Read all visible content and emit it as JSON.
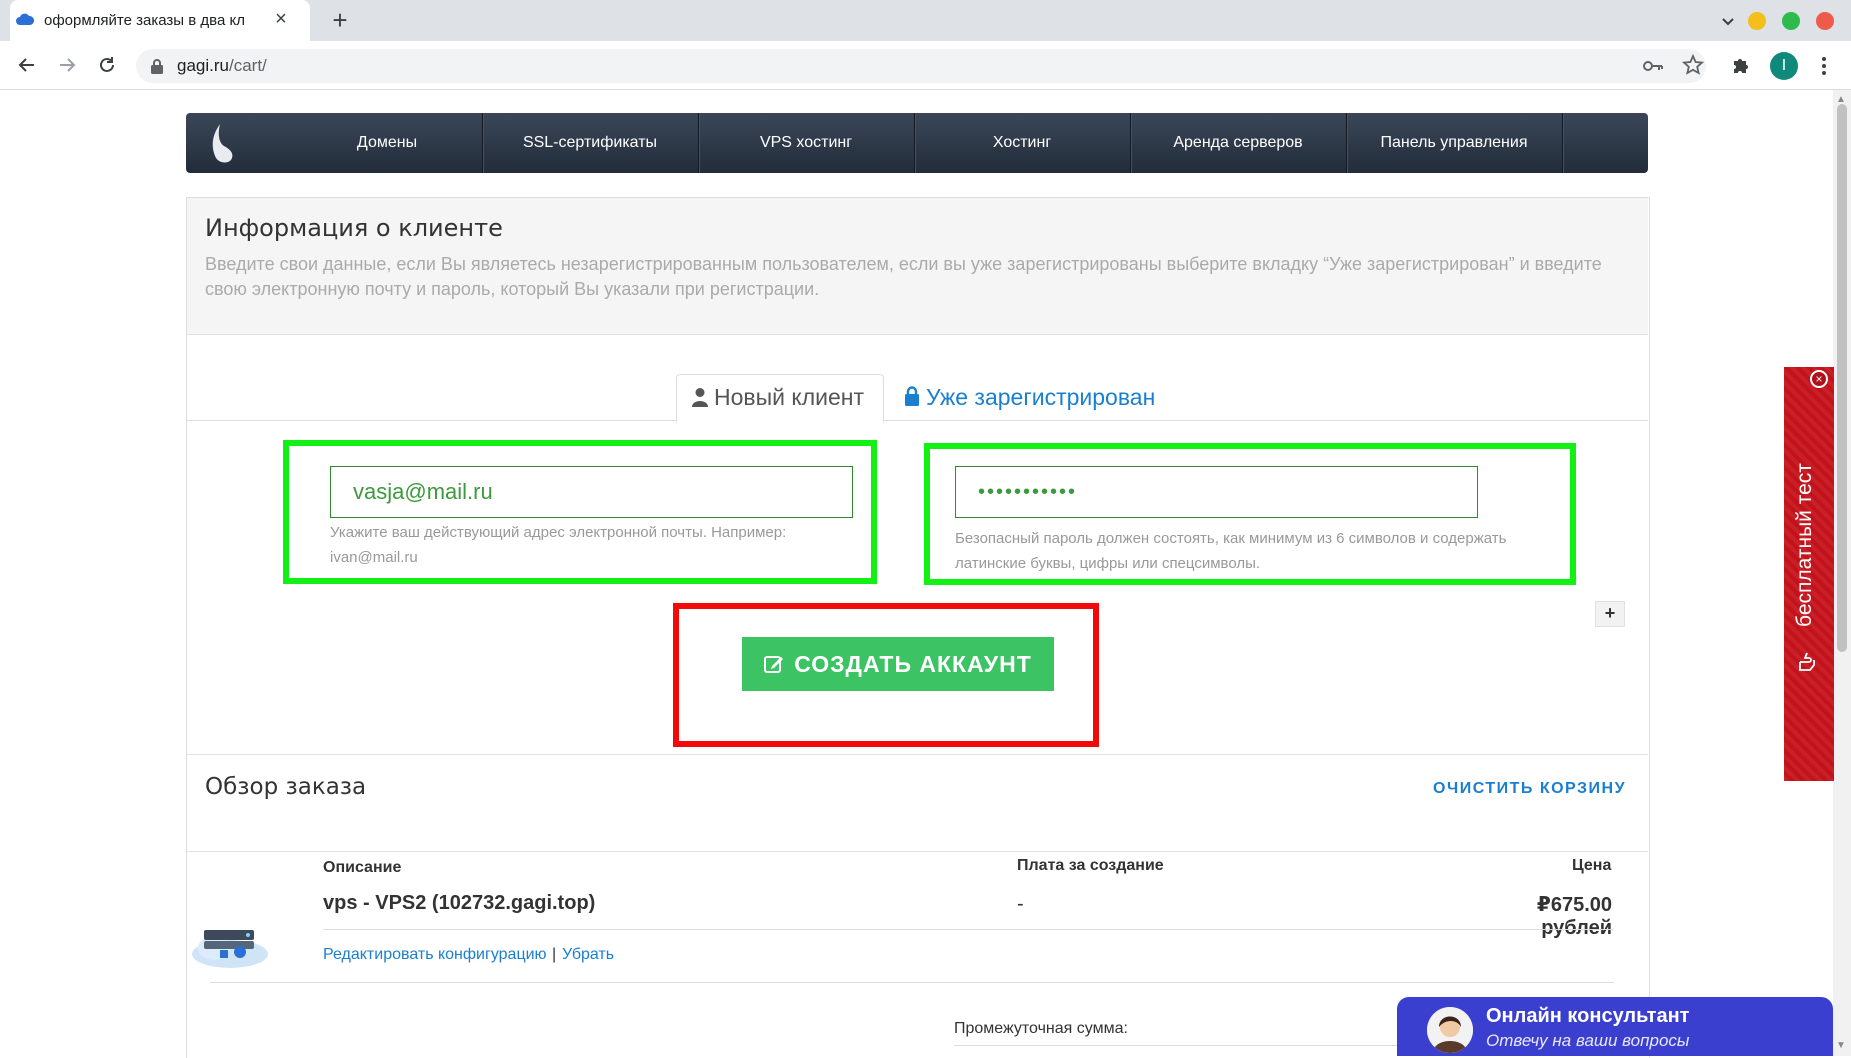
{
  "browser": {
    "tab_title": "оформляйте заказы в два кл",
    "url_host": "gagi.ru",
    "url_path": "/cart/",
    "profile_initial": "I"
  },
  "nav": {
    "items": [
      "Домены",
      "SSL-сертификаты",
      "VPS хостинг",
      "Хостинг",
      "Аренда серверов",
      "Панель управления"
    ]
  },
  "client_info": {
    "title": "Информация о клиенте",
    "description": "Введите свои данные, если Вы являетесь незарегистрированным пользователем, если вы уже зарегистрированы выберите вкладку “Уже зарегистрирован” и введите свою электронную почту и пароль, который Вы указали при регистрации.",
    "tab_new": "Новый клиент",
    "tab_registered": "Уже зарегистрирован",
    "email_value": "vasja@mail.ru",
    "email_hint": "Укажите ваш действующий адрес электронной почты. Например: ivan@mail.ru",
    "password_value": "•••••••••••",
    "password_hint": "Безопасный пароль должен состоять, как минимум из 6 символов и содержать латинские буквы, цифры или спецсимволы.",
    "plus_label": "+",
    "create_button": "СОЗДАТЬ АККАУНТ"
  },
  "order": {
    "title": "Обзор заказа",
    "clear_cart": "ОЧИСТИТЬ КОРЗИНУ",
    "col_description": "Описание",
    "col_setup": "Плата за создание",
    "col_price": "Цена",
    "item_name": "vps - VPS2 (102732.gagi.top)",
    "item_setup": "-",
    "item_price": "₽675.00 рублей",
    "edit_link": "Редактировать конфигурацию",
    "link_separator": "|",
    "remove_link": "Убрать",
    "subtotal_label": "Промежуточная сумма:"
  },
  "side_widget": {
    "label": "бесплатный тест"
  },
  "chat": {
    "title": "Онлайн консультант",
    "subtitle": "Отвечу на ваши вопросы"
  },
  "colors": {
    "highlight_green": "#13f013",
    "highlight_red": "#f20a0a",
    "button_green": "#3cc364",
    "link_blue": "#1a7fd0",
    "nav_dark": "#2a3444",
    "side_red": "#c4121b",
    "chat_blue": "#3b3fd0"
  }
}
